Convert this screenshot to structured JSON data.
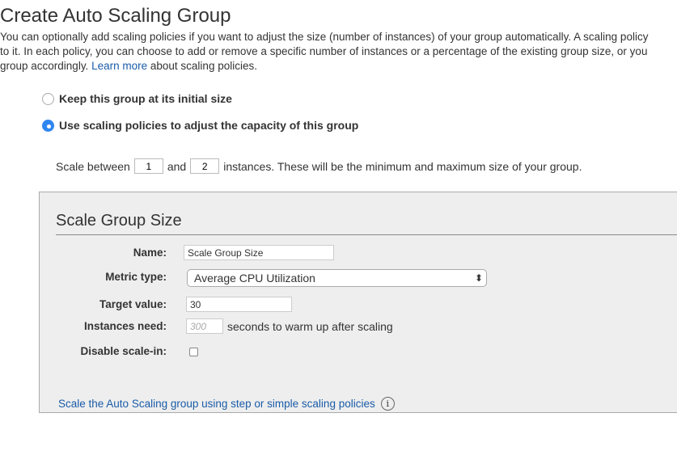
{
  "header": {
    "title": "Create Auto Scaling Group",
    "intro_line1": "You can optionally add scaling policies if you want to adjust the size (number of instances) of your group automatically. A scaling policy",
    "intro_line2": "to it. In each policy, you can choose to add or remove a specific number of instances or a percentage of the existing group size, or you",
    "intro_line3_pre": "group accordingly.",
    "learn_more": "Learn more",
    "intro_line3_post": "about scaling policies."
  },
  "options": [
    {
      "label": "Keep this group at its initial size",
      "selected": false
    },
    {
      "label": "Use scaling policies to adjust the capacity of this group",
      "selected": true
    }
  ],
  "scale": {
    "prefix": "Scale between",
    "min": "1",
    "and": "and",
    "max": "2",
    "suffix": "instances. These will be the minimum and maximum size of your group."
  },
  "panel": {
    "title": "Scale Group Size",
    "name_label": "Name:",
    "name_value": "Scale Group Size",
    "metric_label": "Metric type:",
    "metric_value": "Average CPU Utilization",
    "select_arrows": "⬍",
    "target_label": "Target value:",
    "target_value": "30",
    "warmup_label": "Instances need:",
    "warmup_placeholder": "300",
    "warmup_suffix": "seconds to warm up after scaling",
    "disable_label": "Disable scale-in:",
    "link": "Scale the Auto Scaling group using step or simple scaling policies",
    "info_glyph": "i"
  }
}
